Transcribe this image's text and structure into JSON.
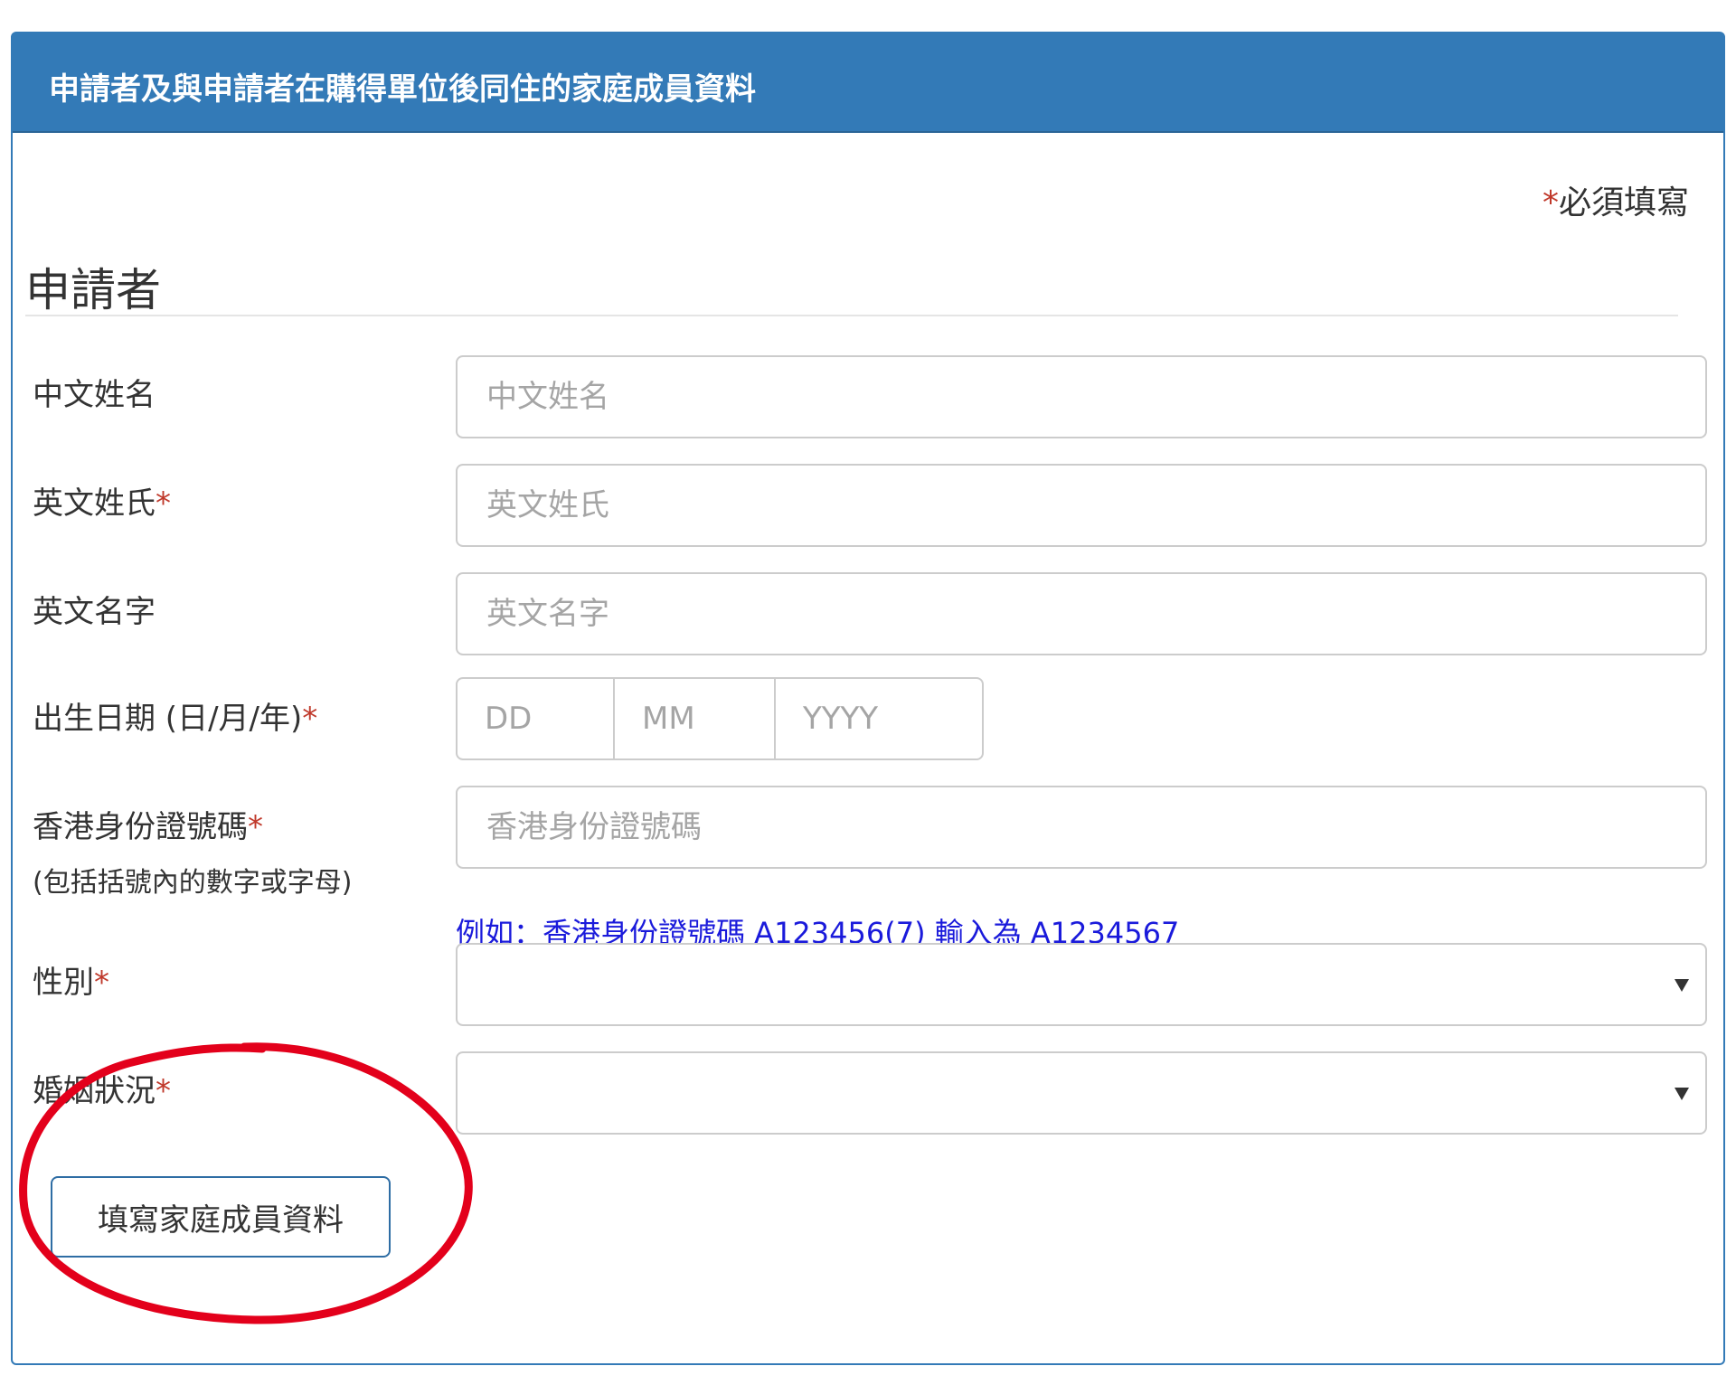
{
  "panel": {
    "title": "申請者及與申請者在購得單位後同住的家庭成員資料",
    "required_note_star": "*",
    "required_note_text": "必須填寫"
  },
  "section": {
    "title": "申請者"
  },
  "form": {
    "chinese_name": {
      "label": "中文姓名",
      "placeholder": "中文姓名",
      "value": ""
    },
    "english_surname": {
      "label": "英文姓氏",
      "required_mark": "*",
      "placeholder": "英文姓氏",
      "value": ""
    },
    "english_given_name": {
      "label": "英文名字",
      "placeholder": "英文名字",
      "value": ""
    },
    "date_of_birth": {
      "label": "出生日期 (日/月/年)",
      "required_mark": "*",
      "day_placeholder": "DD",
      "month_placeholder": "MM",
      "year_placeholder": "YYYY"
    },
    "hkid": {
      "label": "香港身份證號碼",
      "required_mark": "*",
      "sublabel": "(包括括號內的數字或字母)",
      "placeholder": "香港身份證號碼",
      "value": "",
      "help_text": "例如：香港身份證號碼 A123456(7) 輸入為 A1234567"
    },
    "gender": {
      "label": "性別",
      "required_mark": "*",
      "selected": ""
    },
    "marital_status": {
      "label": "婚姻狀況",
      "required_mark": "*",
      "selected": ""
    },
    "family_button_label": "填寫家庭成員資料"
  },
  "colors": {
    "panel_header": "#337ab7",
    "required_star": "#c0392b",
    "help_text": "#1a1adb",
    "annotation_circle": "#e3001b"
  }
}
